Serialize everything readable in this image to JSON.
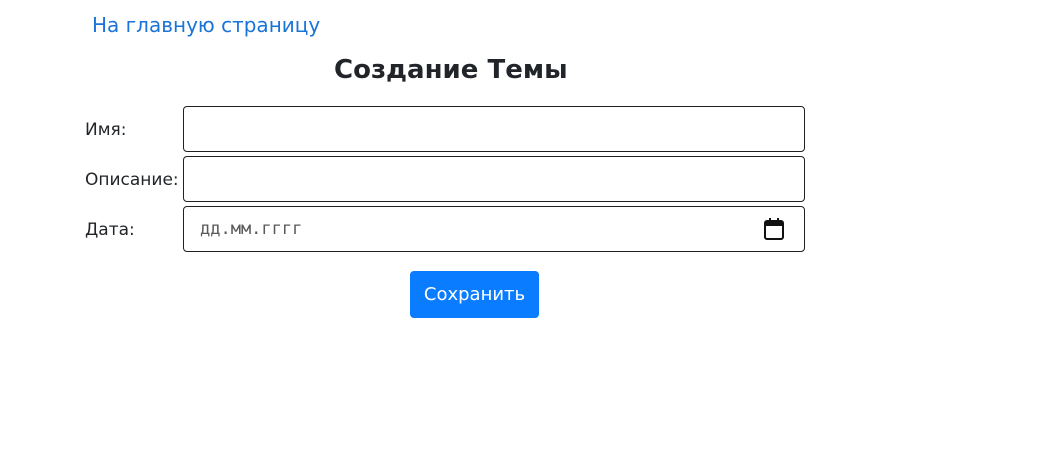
{
  "nav": {
    "home_link": "На главную страницу"
  },
  "form": {
    "title": "Создание Темы",
    "fields": [
      {
        "label": "Имя:",
        "value": "",
        "placeholder": ""
      },
      {
        "label": "Описание:",
        "value": "",
        "placeholder": ""
      },
      {
        "label": "Дата:",
        "placeholder": "дд.мм.гггг",
        "icon": "calendar-icon"
      }
    ],
    "submit_label": "Сохранить"
  },
  "colors": {
    "link": "#1a73d9",
    "primary_button": "#0a7cff",
    "input_border": "#202020"
  }
}
